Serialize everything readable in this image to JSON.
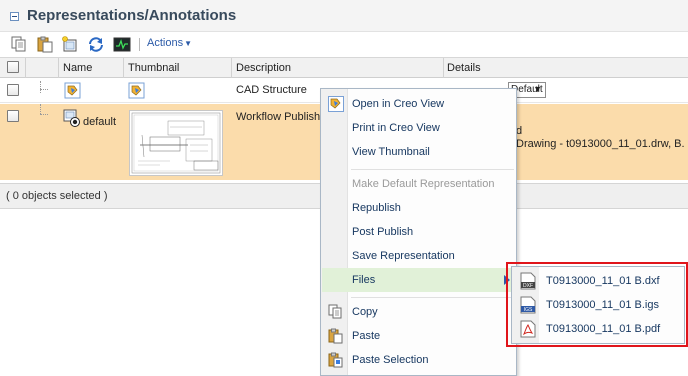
{
  "panel": {
    "title": "Representations/Annotations"
  },
  "toolbar": {
    "buttons": [
      "copy-icon",
      "paste-icon",
      "new-representation-icon",
      "refresh-icon",
      "viewer-icon"
    ],
    "actions_label": "Actions"
  },
  "table": {
    "columns": [
      "Name",
      "Thumbnail",
      "Description",
      "Details"
    ],
    "rows": [
      {
        "name": "",
        "description": "CAD Structure",
        "details_value": "Default"
      },
      {
        "name": "default",
        "description": "Workflow Publish",
        "details_line1": "d",
        "details_line2": "Drawing - t0913000_11_01.drw, B."
      }
    ]
  },
  "selection": {
    "text": "( 0 objects selected )"
  },
  "context_menu": {
    "items": [
      {
        "label": "Open in Creo View",
        "icon": "creo-view-icon",
        "enabled": true
      },
      {
        "label": "Print in Creo View",
        "icon": "",
        "enabled": true
      },
      {
        "label": "View Thumbnail",
        "icon": "",
        "enabled": true
      },
      {
        "label": "Make Default Representation",
        "icon": "",
        "enabled": false
      },
      {
        "label": "Republish",
        "icon": "",
        "enabled": true
      },
      {
        "label": "Post Publish",
        "icon": "",
        "enabled": true
      },
      {
        "label": "Save Representation",
        "icon": "",
        "enabled": true
      },
      {
        "label": "Files",
        "icon": "",
        "enabled": true,
        "submenu": true
      },
      {
        "label": "Copy",
        "icon": "copy-icon",
        "enabled": true
      },
      {
        "label": "Paste",
        "icon": "paste-icon",
        "enabled": true
      },
      {
        "label": "Paste Selection",
        "icon": "paste-selection-icon",
        "enabled": true
      }
    ]
  },
  "files_submenu": {
    "items": [
      {
        "label": "T0913000_11_01 B.dxf",
        "icon": "dxf-file-icon",
        "icon_text": "DXF"
      },
      {
        "label": "T0913000_11_01 B.igs",
        "icon": "igs-file-icon",
        "icon_text": "IGS"
      },
      {
        "label": "T0913000_11_01 B.pdf",
        "icon": "pdf-file-icon",
        "icon_text": ""
      }
    ]
  },
  "colors": {
    "selected_row": "#fbdcab",
    "menu_hover": "#e1f1d8",
    "highlight_border": "#e0151b",
    "link_blue": "#2b5aa7"
  }
}
